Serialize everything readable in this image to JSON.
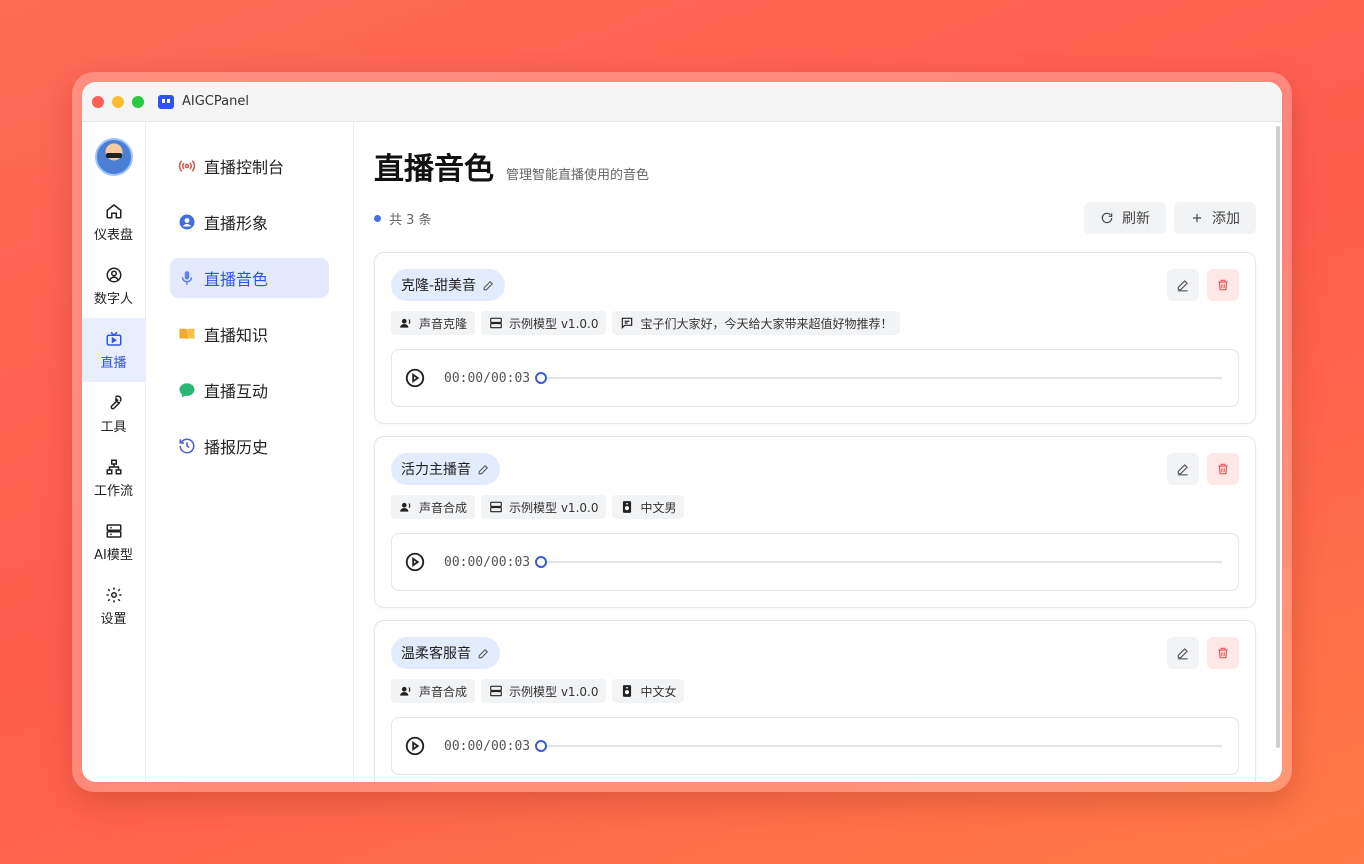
{
  "app": {
    "title": "AIGCPanel"
  },
  "iconbar": {
    "items": [
      {
        "label": "仪表盘",
        "icon": "home-icon"
      },
      {
        "label": "数字人",
        "icon": "user-circle-icon"
      },
      {
        "label": "直播",
        "icon": "tv-icon",
        "active": true
      },
      {
        "label": "工具",
        "icon": "wrench-icon"
      },
      {
        "label": "工作流",
        "icon": "workflow-icon"
      },
      {
        "label": "AI模型",
        "icon": "server-icon"
      },
      {
        "label": "设置",
        "icon": "gear-icon"
      }
    ]
  },
  "subnav": {
    "items": [
      {
        "label": "直播控制台",
        "icon": "broadcast-icon"
      },
      {
        "label": "直播形象",
        "icon": "user-avatar-icon"
      },
      {
        "label": "直播音色",
        "icon": "microphone-icon",
        "active": true
      },
      {
        "label": "直播知识",
        "icon": "book-icon"
      },
      {
        "label": "直播互动",
        "icon": "chat-bubble-icon"
      },
      {
        "label": "播报历史",
        "icon": "history-icon"
      }
    ]
  },
  "main": {
    "title": "直播音色",
    "subtitle": "管理智能直播使用的音色",
    "count_text": "共 3 条",
    "refresh_label": "刷新",
    "add_label": "添加",
    "cards": [
      {
        "name": "克隆-甜美音",
        "tags": [
          "声音克隆",
          "示例模型 v1.0.0",
          "宝子们大家好，今天给大家带来超值好物推荐！"
        ],
        "time": "00:00/00:03"
      },
      {
        "name": "活力主播音",
        "tags": [
          "声音合成",
          "示例模型 v1.0.0",
          "中文男"
        ],
        "time": "00:00/00:03"
      },
      {
        "name": "温柔客服音",
        "tags": [
          "声音合成",
          "示例模型 v1.0.0",
          "中文女"
        ],
        "time": "00:00/00:03"
      }
    ]
  },
  "colors": {
    "accent": "#2f54eb",
    "active_bg": "#e3e9fb",
    "danger": "#f05050"
  }
}
